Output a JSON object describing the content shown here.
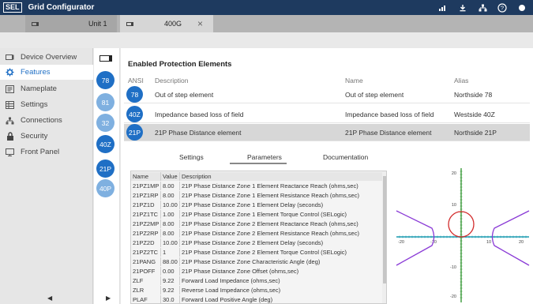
{
  "app": {
    "logo": "SEL",
    "title": "Grid Configurator"
  },
  "titlebar_icons": [
    "signal-icon",
    "download-icon",
    "network-icon",
    "help-icon",
    "status-dot-icon"
  ],
  "tabs": [
    {
      "label": "Unit 1"
    },
    {
      "label": "400G",
      "close": "×"
    }
  ],
  "sidebar": {
    "items": [
      {
        "label": "Device Overview",
        "icon": "device-icon"
      },
      {
        "label": "Features",
        "icon": "gear-icon",
        "active": true
      },
      {
        "label": "Nameplate",
        "icon": "nameplate-icon"
      },
      {
        "label": "Settings",
        "icon": "table-icon"
      },
      {
        "label": "Connections",
        "icon": "connections-icon"
      },
      {
        "label": "Security",
        "icon": "lock-icon"
      },
      {
        "label": "Front Panel",
        "icon": "monitor-icon"
      }
    ],
    "prev": "◀",
    "next": "▶"
  },
  "rail": [
    "78",
    "81",
    "32",
    "40Z",
    "21P",
    "40P"
  ],
  "main": {
    "title": "Enabled Protection Elements",
    "headers": {
      "ansi": "ANSI",
      "description": "Description",
      "name": "Name",
      "alias": "Alias"
    },
    "rows": [
      {
        "ansi": "78",
        "description": "Out of step element",
        "name": "Out of step element",
        "alias": "Northside 78"
      },
      {
        "ansi": "40Z",
        "description": "Impedance based loss of field",
        "name": "Impedance based loss of field",
        "alias": "Westside 40Z"
      },
      {
        "ansi": "21P",
        "description": "21P Phase Distance element",
        "name": "21P Phase Distance element",
        "alias": "Northside 21P",
        "selected": true
      }
    ],
    "subtabs": [
      "Settings",
      "Parameters",
      "Documentation"
    ]
  },
  "params": {
    "headers": {
      "name": "Name",
      "value": "Value",
      "description": "Description"
    },
    "rows": [
      {
        "name": "21PZ1MP",
        "value": "8.00",
        "description": "21P Phase Distance Zone 1 Element Reactance Reach (ohms,sec)"
      },
      {
        "name": "21PZ1RP",
        "value": "8.00",
        "description": "21P Phase Distance Zone 1 Element Resistance Reach (ohms,sec)"
      },
      {
        "name": "21PZ1D",
        "value": "10.00",
        "description": "21P Phase Distance Zone 1 Element Delay (seconds)"
      },
      {
        "name": "21PZ1TC",
        "value": "1.00",
        "description": "21P Phase Distance Zone 1 Element Torque Control (SELogic)"
      },
      {
        "name": "21PZ2MP",
        "value": "8.00",
        "description": "21P Phase Distance Zone 2 Element Reactance Reach (ohms,sec)"
      },
      {
        "name": "21PZ2RP",
        "value": "8.00",
        "description": "21P Phase Distance Zone 2 Element Resistance Reach (ohms,sec)"
      },
      {
        "name": "21PZ2D",
        "value": "10.00",
        "description": "21P Phase Distance Zone 2 Element Delay (seconds)"
      },
      {
        "name": "21PZ2TC",
        "value": "1",
        "description": "21P Phase Distance Zone 2 Element Torque Control (SELogic)"
      },
      {
        "name": "21PANG",
        "value": "88.00",
        "description": "21P Phase Distance Zone Characteristic Angle (deg)"
      },
      {
        "name": "21POFF",
        "value": "0.00",
        "description": "21P Phase Distance Zone Offset (ohms,sec)"
      },
      {
        "name": "ZLF",
        "value": "9.22",
        "description": "Forward Load Impedance (ohms,sec)"
      },
      {
        "name": "ZLR",
        "value": "9.22",
        "description": "Reverse Load Impedance (ohms,sec)"
      },
      {
        "name": "PLAF",
        "value": "30.0",
        "description": "Forward Load Positive Angle (deg)"
      }
    ]
  },
  "plot": {
    "x_ticks": [
      "-20",
      "-10",
      "10",
      "20"
    ],
    "y_ticks": [
      "20",
      "10",
      "-10",
      "-20"
    ],
    "colors": {
      "axis_x": "#1a9bb0",
      "axis_y": "#3a9a3a",
      "load_encroachment": "#8a3ad6",
      "zone_circle": "#d22b2b"
    }
  }
}
